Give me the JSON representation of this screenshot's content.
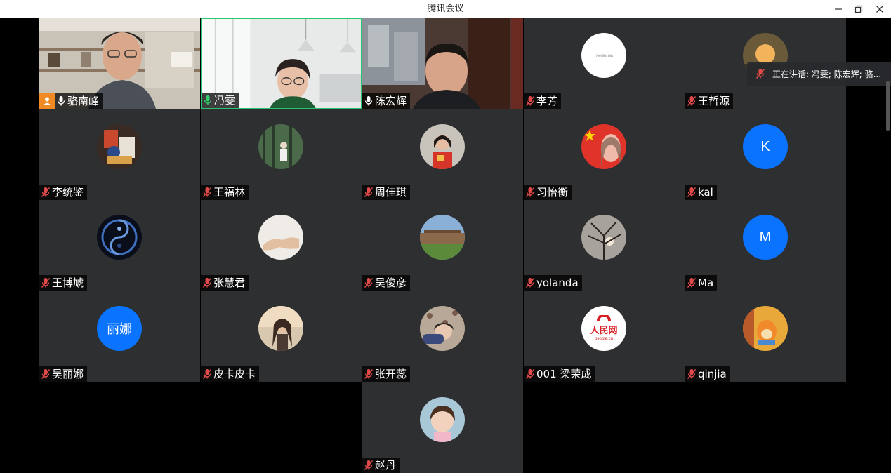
{
  "window": {
    "title": "腾讯会议",
    "minimize_icon": "minimize-icon",
    "restore_icon": "restore-icon",
    "close_icon": "close-icon"
  },
  "speaking": {
    "label": "正在讲话: 冯雯; 陈宏辉; 骆..."
  },
  "colors": {
    "tile_bg": "#2e2f31",
    "avatar_blue": "#0a73ff",
    "mic_muted": "#e24a4a",
    "mic_active": "#2fd06b",
    "host_badge": "#f08a24",
    "active_border": "#28c76f"
  },
  "participants": [
    {
      "name": "骆南峰",
      "mic": "on",
      "host": true,
      "video": true
    },
    {
      "name": "冯雯",
      "mic": "on-speaking",
      "host": false,
      "video": true
    },
    {
      "name": "陈宏辉",
      "mic": "on",
      "host": false,
      "video": true
    },
    {
      "name": "李芳",
      "mic": "muted",
      "avatar_text": "I feel like this"
    },
    {
      "name": "王哲源",
      "mic": "muted",
      "avatar": "photo"
    },
    {
      "name": "李统鉴",
      "mic": "muted",
      "avatar": "photo"
    },
    {
      "name": "王福林",
      "mic": "muted",
      "avatar": "photo"
    },
    {
      "name": "周佳琪",
      "mic": "muted",
      "avatar": "photo"
    },
    {
      "name": "习怡衡",
      "mic": "muted",
      "avatar": "photo"
    },
    {
      "name": "kal",
      "mic": "muted",
      "avatar_letter": "K"
    },
    {
      "name": "王博虓",
      "mic": "muted",
      "avatar": "photo"
    },
    {
      "name": "张慧君",
      "mic": "muted",
      "avatar": "photo"
    },
    {
      "name": "吴俊彦",
      "mic": "muted",
      "avatar": "photo"
    },
    {
      "name": "yolanda",
      "mic": "muted",
      "avatar": "photo"
    },
    {
      "name": "Ma",
      "mic": "muted",
      "avatar_letter": "M"
    },
    {
      "name": "吴丽娜",
      "mic": "muted",
      "avatar_letter": "丽娜"
    },
    {
      "name": "皮卡皮卡",
      "mic": "muted",
      "avatar": "photo"
    },
    {
      "name": "张开蕊",
      "mic": "muted",
      "avatar": "photo"
    },
    {
      "name": "001 梁荣成",
      "mic": "muted",
      "avatar_logo": "人民网",
      "avatar_logo_sub": "people.cn"
    },
    {
      "name": "qinjia",
      "mic": "muted",
      "avatar": "photo"
    },
    {
      "name": "赵丹",
      "mic": "muted",
      "avatar": "photo"
    }
  ]
}
